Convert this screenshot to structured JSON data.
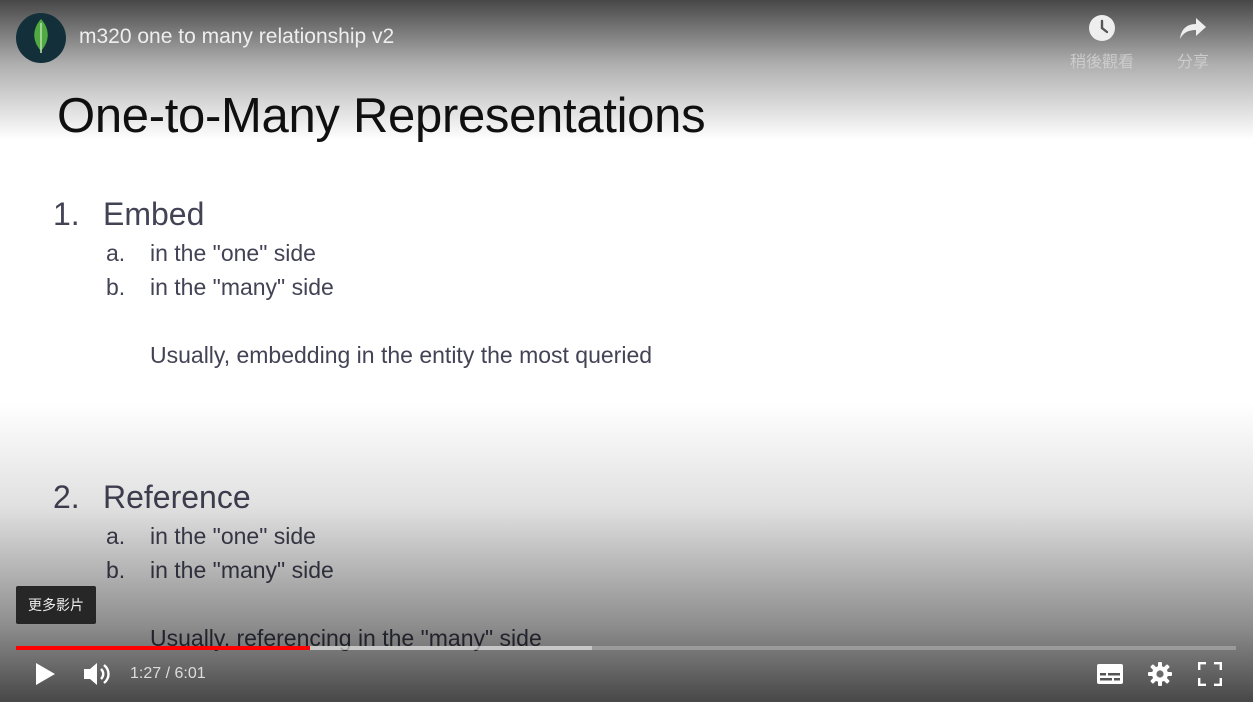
{
  "video": {
    "title": "m320 one to many relationship v2",
    "watch_later_label": "稍後觀看",
    "share_label": "分享",
    "more_videos_tooltip": "更多影片"
  },
  "slide": {
    "title": "One-to-Many Representations",
    "sections": [
      {
        "number": "1.",
        "heading": "Embed",
        "items": [
          {
            "letter": "a.",
            "text": "in the \"one\" side"
          },
          {
            "letter": "b.",
            "text": "in the \"many\" side"
          }
        ],
        "note": "Usually, embedding in the entity the most queried"
      },
      {
        "number": "2.",
        "heading": "Reference",
        "items": [
          {
            "letter": "a.",
            "text": "in the \"one\" side"
          },
          {
            "letter": "b.",
            "text": "in the \"many\" side"
          }
        ],
        "note": "Usually, referencing in the \"many\" side"
      }
    ]
  },
  "player": {
    "current_time": "1:27",
    "separator": " / ",
    "duration": "6:01",
    "played_fraction": 0.241,
    "buffered_fraction": 0.472,
    "colors": {
      "progress_played": "#ff0000",
      "channel_leaf": "#4faa41"
    },
    "icons": [
      "channel-logo-icon",
      "clock-icon",
      "share-arrow-icon",
      "play-icon",
      "volume-icon",
      "subtitles-icon",
      "gear-icon",
      "fullscreen-icon"
    ]
  }
}
